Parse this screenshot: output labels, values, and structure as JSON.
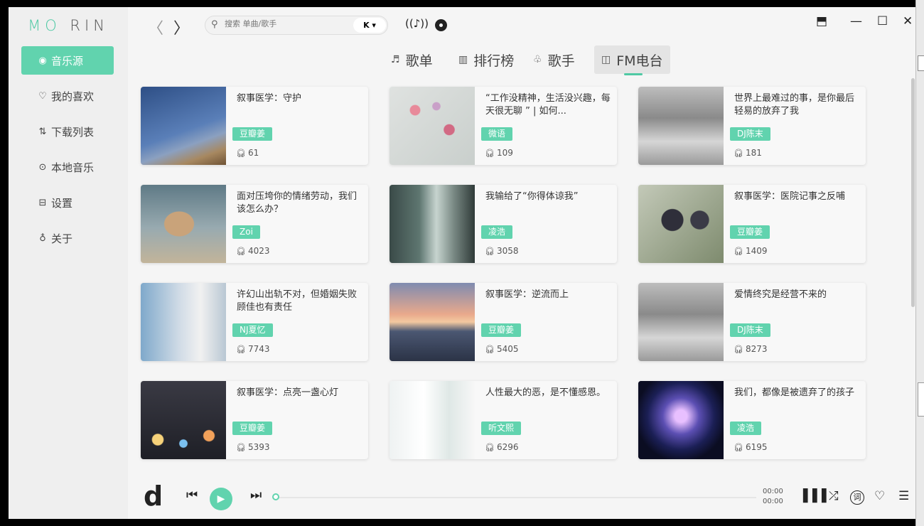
{
  "app": {
    "logo_left": "MO",
    "logo_right": "RIN"
  },
  "sidebar": {
    "items": [
      {
        "label": "音乐源",
        "icon": "music-source-icon"
      },
      {
        "label": "我的喜欢",
        "icon": "heart-icon"
      },
      {
        "label": "下载列表",
        "icon": "download-sort-icon"
      },
      {
        "label": "本地音乐",
        "icon": "local-play-icon"
      },
      {
        "label": "设置",
        "icon": "settings-icon"
      },
      {
        "label": "关于",
        "icon": "bulb-icon"
      }
    ]
  },
  "header": {
    "search_placeholder": "搜索 单曲/歌手",
    "source_label": "K ▾",
    "window_buttons": [
      "minimize",
      "maximize",
      "close"
    ]
  },
  "tabs": [
    {
      "label": "歌单",
      "icon": "playlist-icon"
    },
    {
      "label": "排行榜",
      "icon": "chart-icon"
    },
    {
      "label": "歌手",
      "icon": "singer-icon"
    },
    {
      "label": "FM电台",
      "icon": "radio-icon",
      "active": true
    }
  ],
  "cards": [
    {
      "title": "叙事医学：守护",
      "tag": "豆瓣姜",
      "plays": "61",
      "thumb": "sky-rock"
    },
    {
      "title": "“工作没精神，生活没兴趣，每天很无聊 ” | 如何...",
      "tag": "微语",
      "plays": "109",
      "thumb": "flowers"
    },
    {
      "title": "世界上最难过的事，是你最后轻易的放弃了我",
      "tag": "DJ陈末",
      "plays": "181",
      "thumb": "boy"
    },
    {
      "title": "面对压垮你的情绪劳动，我们该怎么办？",
      "tag": "Zoi",
      "plays": "4023",
      "thumb": "box-robot"
    },
    {
      "title": "我输给了“你得体谅我”",
      "tag": "凌浩",
      "plays": "3058",
      "thumb": "window-girl"
    },
    {
      "title": "叙事医学：医院记事之反哺",
      "tag": "豆瓣姜",
      "plays": "1409",
      "thumb": "birds"
    },
    {
      "title": "许幻山出轨不对，但婚姻失败顾佳也有责任",
      "tag": "NJ夏忆",
      "plays": "7743",
      "thumb": "woman"
    },
    {
      "title": "叙事医学：逆流而上",
      "tag": "豆瓣姜",
      "plays": "5405",
      "thumb": "sea-sunset"
    },
    {
      "title": "爱情终究是经营不来的",
      "tag": "DJ陈末",
      "plays": "8273",
      "thumb": "boy"
    },
    {
      "title": "叙事医学：点亮一盏心灯",
      "tag": "豆瓣姜",
      "plays": "5393",
      "thumb": "bokeh"
    },
    {
      "title": "人性最大的恶，是不懂感恩。",
      "tag": "听文熙",
      "plays": "6296",
      "thumb": "curtain"
    },
    {
      "title": "我们，都像是被遗弃了的孩子",
      "tag": "凌浩",
      "plays": "6195",
      "thumb": "sphere"
    }
  ],
  "player": {
    "logo": "d",
    "time_current": "00:00",
    "time_total": "00:00",
    "lyrics_label": "词"
  },
  "colors": {
    "accent": "#61d3ae",
    "background": "#f5f5f5",
    "sidebar": "#efefef"
  }
}
